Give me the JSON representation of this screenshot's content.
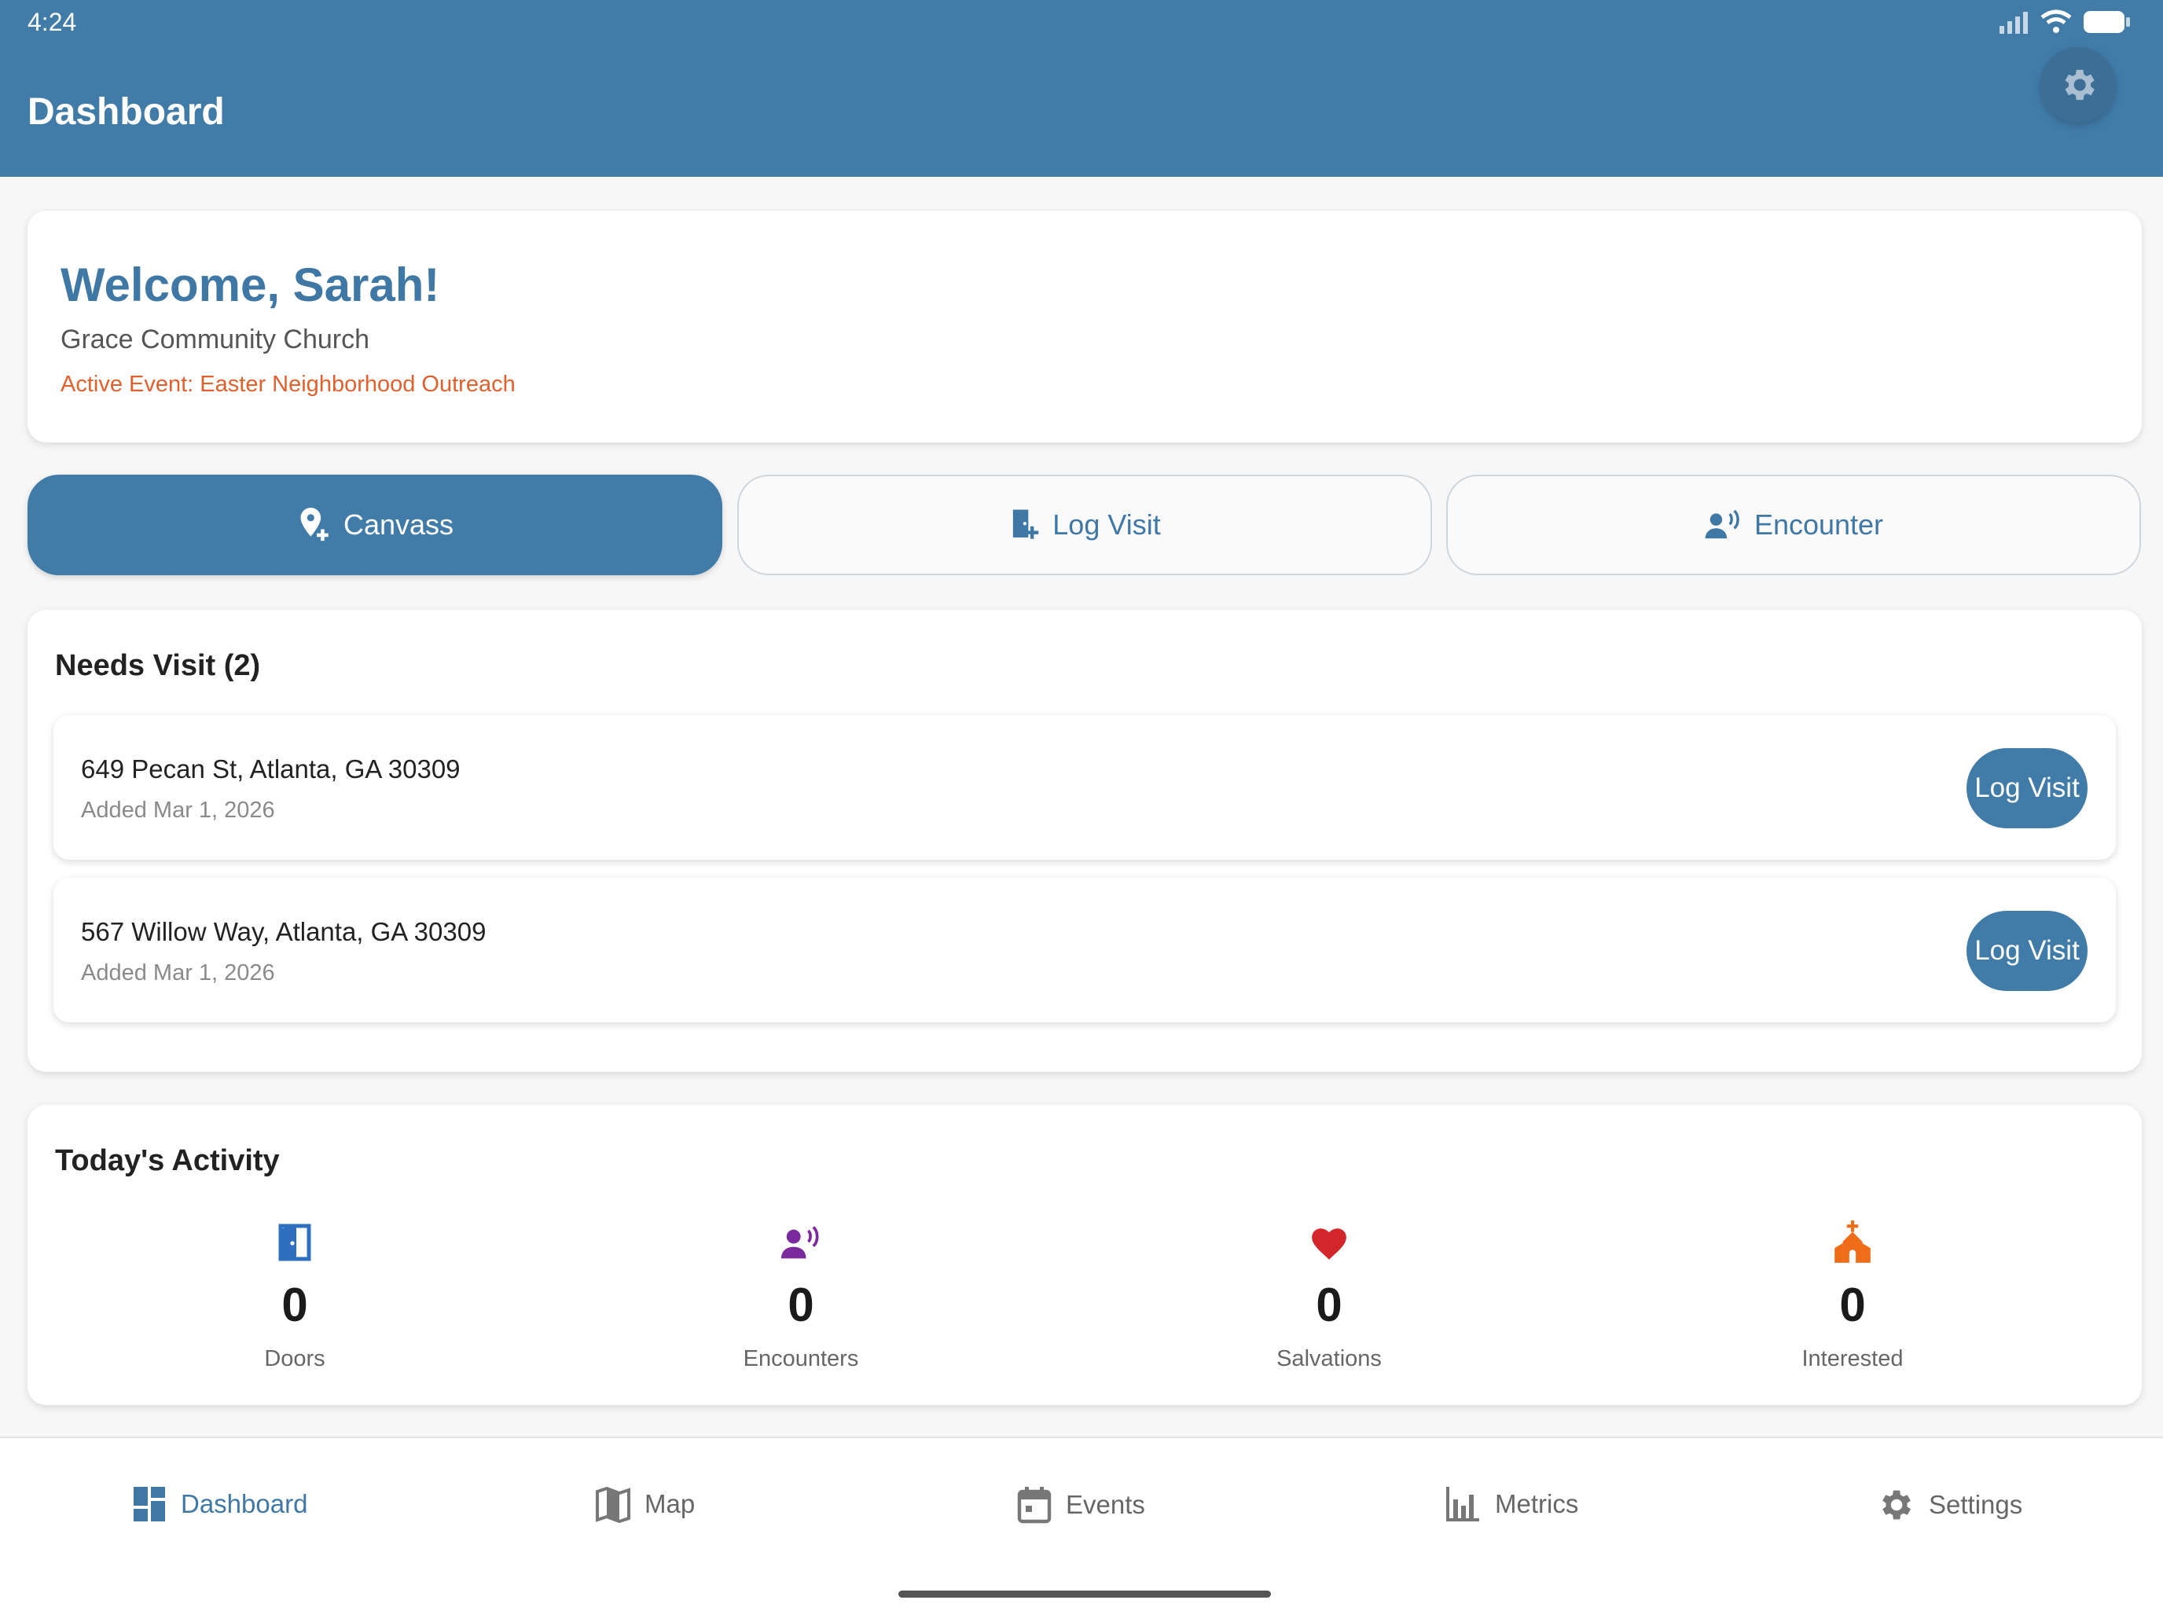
{
  "status": {
    "time": "4:24"
  },
  "header": {
    "title": "Dashboard"
  },
  "welcome": {
    "title": "Welcome, Sarah!",
    "church": "Grace Community Church",
    "event": "Active Event: Easter Neighborhood Outreach"
  },
  "actions": [
    {
      "label": "Canvass",
      "icon": "location-plus-icon"
    },
    {
      "label": "Log Visit",
      "icon": "door-plus-icon"
    },
    {
      "label": "Encounter",
      "icon": "person-voice-icon"
    }
  ],
  "needs_visit": {
    "title": "Needs Visit (2)",
    "items": [
      {
        "address": "649 Pecan St, Atlanta, GA 30309",
        "date": "Added Mar 1, 2026",
        "button": "Log Visit"
      },
      {
        "address": "567 Willow Way, Atlanta, GA 30309",
        "date": "Added Mar 1, 2026",
        "button": "Log Visit"
      }
    ]
  },
  "activity": {
    "title": "Today's Activity",
    "stats": [
      {
        "value": "0",
        "label": "Doors",
        "icon": "door-icon",
        "color": "#2f6fc0"
      },
      {
        "value": "0",
        "label": "Encounters",
        "icon": "person-voice-icon",
        "color": "#7b2a9e"
      },
      {
        "value": "0",
        "label": "Salvations",
        "icon": "heart-icon",
        "color": "#d3262b"
      },
      {
        "value": "0",
        "label": "Interested",
        "icon": "church-icon",
        "color": "#ef6c18"
      }
    ]
  },
  "nav": {
    "items": [
      {
        "label": "Dashboard",
        "icon": "dashboard-icon"
      },
      {
        "label": "Map",
        "icon": "map-icon"
      },
      {
        "label": "Events",
        "icon": "calendar-icon"
      },
      {
        "label": "Metrics",
        "icon": "bar-chart-icon"
      },
      {
        "label": "Settings",
        "icon": "gear-icon"
      }
    ]
  },
  "colors": {
    "primary": "#417ca9",
    "event_accent": "#e0602e"
  }
}
